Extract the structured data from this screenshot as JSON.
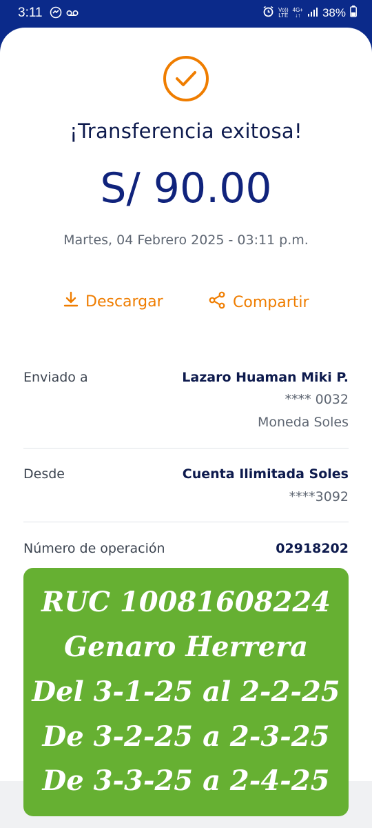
{
  "status_bar": {
    "time": "3:11",
    "network_top": "Vo))",
    "network_bottom": "LTE",
    "signal_type": "4G+",
    "battery": "38%"
  },
  "receipt": {
    "title": "¡Transferencia exitosa!",
    "amount": "S/ 90.00",
    "datetime": "Martes, 04 Febrero 2025 - 03:11 p.m.",
    "accent_color": "#ef7d00",
    "primary_color": "#10237c"
  },
  "actions": {
    "download_label": "Descargar",
    "share_label": "Compartir"
  },
  "details": {
    "sent_to_label": "Enviado a",
    "recipient_name": "Lazaro Huaman Miki P.",
    "recipient_account": "**** 0032",
    "currency": "Moneda Soles",
    "from_label": "Desde",
    "from_account_name": "Cuenta Ilimitada Soles",
    "from_account_number": "****3092",
    "operation_label": "Número de operación",
    "operation_number": "02918202"
  },
  "stamp": {
    "color": "#66b032",
    "lines": [
      "RUC 10081608224",
      "Genaro Herrera",
      "Del 3-1-25 al 2-2-25",
      "De 3-2-25 a 2-3-25",
      "De 3-3-25 a 2-4-25"
    ]
  }
}
